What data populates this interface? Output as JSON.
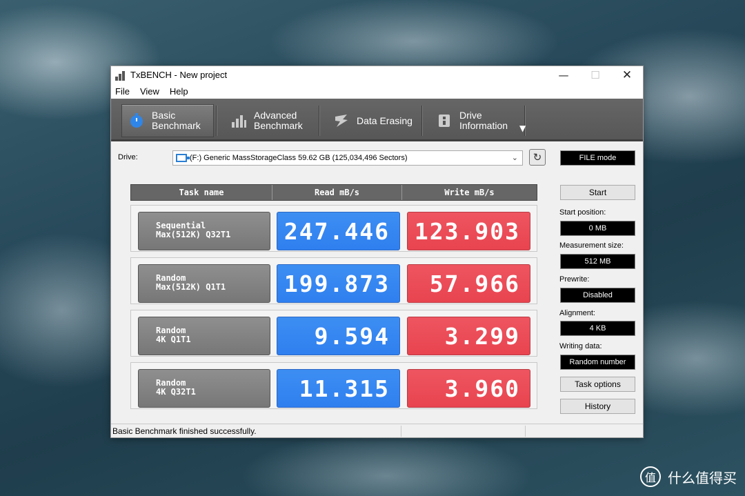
{
  "window": {
    "title": "TxBENCH - New project",
    "controls": {
      "minimize": "—",
      "maximize": "☐",
      "close": "✕"
    }
  },
  "menu": [
    "File",
    "View",
    "Help"
  ],
  "toolbar": {
    "tabs": [
      {
        "line1": "Basic",
        "line2": "Benchmark",
        "icon": "stopwatch-icon",
        "active": true
      },
      {
        "line1": "Advanced",
        "line2": "Benchmark",
        "icon": "bar-chart-icon",
        "active": false
      },
      {
        "line1": "Data Erasing",
        "line2": "",
        "icon": "eraser-icon",
        "active": false
      },
      {
        "line1": "Drive",
        "line2": "Information",
        "icon": "drive-info-icon",
        "active": false
      }
    ],
    "dropdown": "▼"
  },
  "drive": {
    "label": "Drive:",
    "selected": "(F:) Generic MassStorageClass  59.62 GB (125,034,496 Sectors)",
    "refresh_icon": "↻",
    "mode": "FILE mode"
  },
  "table": {
    "headers": [
      "Task name",
      "Read mB/s",
      "Write mB/s"
    ],
    "rows": [
      {
        "task_line1": "Sequential",
        "task_line2": "Max(512K) Q32T1",
        "read": "247.446",
        "write": "123.903"
      },
      {
        "task_line1": "Random",
        "task_line2": "Max(512K) Q1T1",
        "read": "199.873",
        "write": "57.966"
      },
      {
        "task_line1": "Random",
        "task_line2": "4K Q1T1",
        "read": "9.594",
        "write": "3.299"
      },
      {
        "task_line1": "Random",
        "task_line2": "4K Q32T1",
        "read": "11.315",
        "write": "3.960"
      }
    ]
  },
  "panel": {
    "start_button": "Start",
    "start_position": {
      "label": "Start position:",
      "value": "0 MB"
    },
    "measurement_size": {
      "label": "Measurement size:",
      "value": "512 MB"
    },
    "prewrite": {
      "label": "Prewrite:",
      "value": "Disabled"
    },
    "alignment": {
      "label": "Alignment:",
      "value": "4 KB"
    },
    "writing_data": {
      "label": "Writing data:",
      "value": "Random number"
    },
    "task_options_button": "Task options",
    "history_button": "History"
  },
  "status": "Basic Benchmark finished successfully.",
  "watermark": {
    "icon": "值",
    "text": "什么值得买"
  },
  "colors": {
    "read": "#3d8ef2",
    "write": "#e8444f",
    "toolbar": "#5e5e5e"
  }
}
